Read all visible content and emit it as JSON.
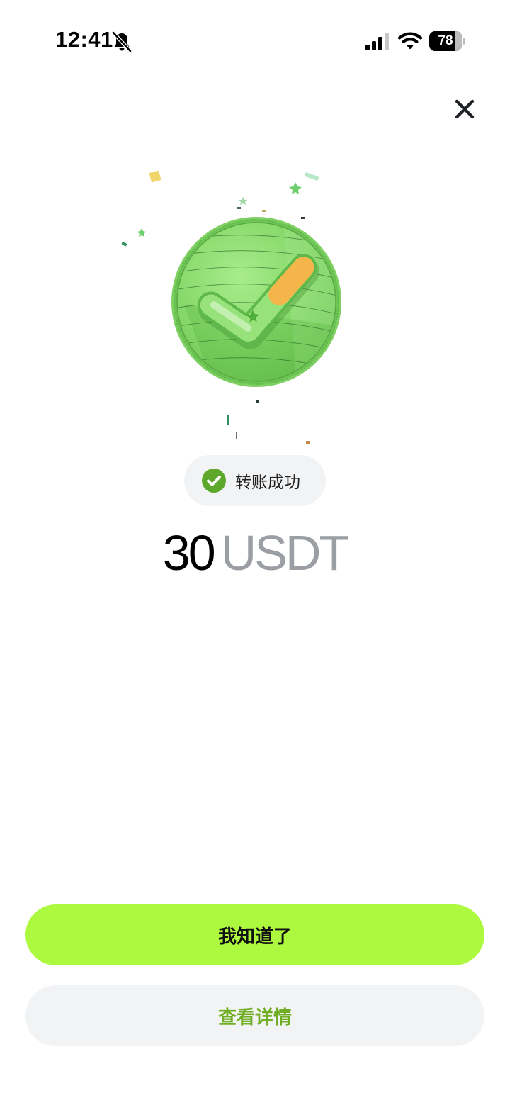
{
  "status_bar": {
    "time": "12:41",
    "battery_level": "78",
    "icons": [
      "bell-slash-icon",
      "cellular-signal-icon",
      "wifi-icon",
      "battery-icon"
    ]
  },
  "header": {
    "close_icon": "close-icon"
  },
  "illustration": {
    "icon": "check-coin-icon",
    "colors": {
      "coin": "#8bdc6f",
      "check": "#7fd45d",
      "check_accent": "#f4b54a"
    }
  },
  "transfer": {
    "status_icon": "check-circle-icon",
    "status_text": "转账成功",
    "amount": "30",
    "currency": "USDT"
  },
  "actions": {
    "primary_label": "我知道了",
    "secondary_label": "查看详情"
  },
  "colors": {
    "accent": "#adf940",
    "secondary_text": "#6fae22",
    "status_check": "#5da82a",
    "muted": "#9b9ea3"
  }
}
